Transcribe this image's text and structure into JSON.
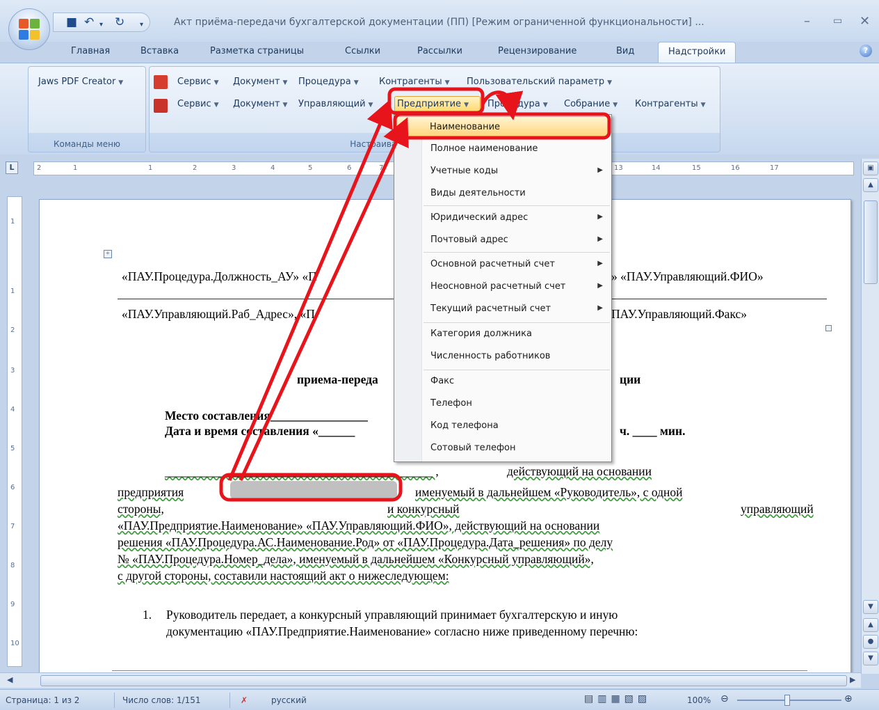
{
  "window": {
    "title": "Акт приёма-передачи бухгалтерской документации (ПП) [Режим ограниченной функциональности] - ...",
    "title_short": "Акт приёма-передачи бухгалтерской документации (ПП) [Режим ограниченной функциональности] ..."
  },
  "qat": {
    "save_icon": "save-icon",
    "undo_icon": "undo-icon",
    "redo_icon": "redo-icon"
  },
  "tabs": [
    "Главная",
    "Вставка",
    "Разметка страницы",
    "Ссылки",
    "Рассылки",
    "Рецензирование",
    "Вид",
    "Надстройки"
  ],
  "ribbon": {
    "group1": {
      "button": "Jaws PDF Creator",
      "label": "Команды меню"
    },
    "group2": {
      "row1": [
        "Сервис",
        "Документ",
        "Процедура",
        "Контрагенты",
        "Пользовательский параметр"
      ],
      "row2": [
        "Сервис",
        "Документ",
        "Управляющий",
        "Предприятие",
        "Процедура",
        "Собрание",
        "Контрагенты"
      ],
      "label": "Настраиваемые панели инструментов"
    }
  },
  "ruler": [
    "2",
    "1",
    "1",
    "2",
    "3",
    "4",
    "5",
    "6",
    "7",
    "13",
    "14",
    "15",
    "16",
    "17"
  ],
  "menu": {
    "items": [
      {
        "label": "Наименование",
        "submenu": false,
        "highlighted": true
      },
      {
        "label": "Полное наименование",
        "submenu": false
      },
      {
        "label": "Учетные коды",
        "submenu": true
      },
      {
        "label": "Виды деятельности",
        "submenu": false
      },
      {
        "label": "Юридический адрес",
        "submenu": true
      },
      {
        "label": "Почтовый адрес",
        "submenu": true
      },
      {
        "label": "Основной расчетный счет",
        "submenu": true
      },
      {
        "label": "Неосновной расчетный счет",
        "submenu": true
      },
      {
        "label": "Текущий расчетный счет",
        "submenu": true
      },
      {
        "label": "Категория должника",
        "submenu": false
      },
      {
        "label": "Численность работников",
        "submenu": false
      },
      {
        "label": "Факс",
        "submenu": false
      },
      {
        "label": "Телефон",
        "submenu": false
      },
      {
        "label": "Код телефона",
        "submenu": false
      },
      {
        "label": "Сотовый телефон",
        "submenu": false
      }
    ]
  },
  "doc": {
    "line1_left": "«ПАУ.Процедура.Должность_АУ» «П",
    "line1_right": "» «ПАУ.Управляющий.ФИО»",
    "line2_left": "«ПАУ.Управляющий.Раб_Адрес», «П",
    "line2_right": "ПАУ.Управляющий.Факс»",
    "heading_left": "приема-переда",
    "heading_right": "ции",
    "place": "Место составления",
    "date": "Дата и время составления «",
    "date_right": "ч. ____ мин.",
    "p1_right": "действующий    на    основании",
    "p2_left": "предприятия",
    "p2_right": "именуемый  в дальнейшем  «Руководитель»,  с одной",
    "p3_left": "стороны,",
    "p3_mid": "и конкурсный",
    "p3_right": "управляющий",
    "p4": "«ПАУ.Предприятие.Наименование» «ПАУ.Управляющий.ФИО»,  действующий  на  основании",
    "p5": "решения «ПАУ.Процедура.АС.Наименование.Род» от «ПАУ.Процедура.Дата_решения» по делу",
    "p6": "№  «ПАУ.Процедура.Номер_дела»,  именуемый  в дальнейшем  «Конкурсный  управляющий»,",
    "p7": "с другой стороны, составили настоящий акт о нижеследующем:",
    "li_num": "1.",
    "li1": "Руководитель передает, а конкурсный управляющий принимает бухгалтерскую и иную",
    "li2": "документацию «ПАУ.Предприятие.Наименование» согласно ниже приведенному перечню:"
  },
  "vruler": [
    "1",
    "1",
    "2",
    "3",
    "4",
    "5",
    "6",
    "7",
    "8",
    "9",
    "10"
  ],
  "status": {
    "page": "Страница: 1 из 2",
    "words": "Число слов: 1/151",
    "lang": "русский",
    "zoom": "100%"
  },
  "colors": {
    "annotation_red": "#e8141b",
    "menu_highlight": "#ffd57a"
  }
}
